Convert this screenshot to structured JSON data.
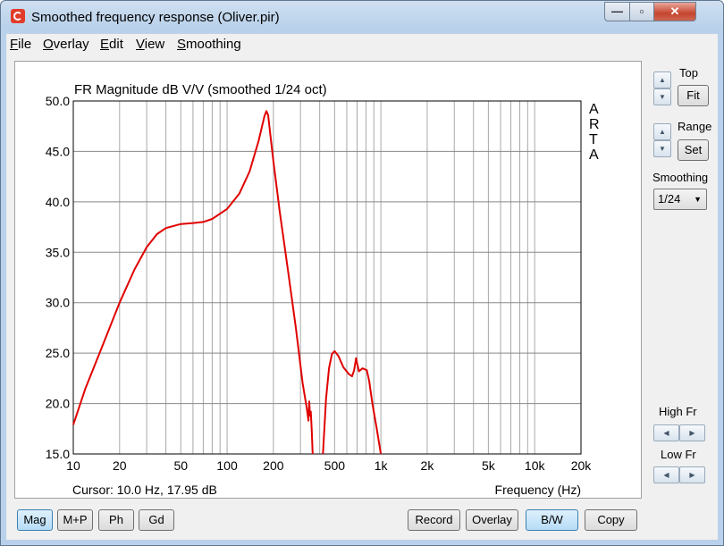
{
  "window": {
    "title": "Smoothed frequency response (Oliver.pir)",
    "min_glyph": "—",
    "max_glyph": "▫",
    "close_glyph": "✕"
  },
  "menu": [
    "File",
    "Overlay",
    "Edit",
    "View",
    "Smoothing"
  ],
  "chart_data": {
    "type": "line",
    "title": "FR Magnitude dB V/V (smoothed 1/24 oct)",
    "watermark": "ARTA",
    "xlabel": "Frequency (Hz)",
    "x_scale": "log",
    "xlim": [
      10,
      20000
    ],
    "ylim": [
      15,
      50
    ],
    "x_ticks": [
      10,
      20,
      50,
      100,
      200,
      500,
      1000,
      2000,
      5000,
      10000,
      20000
    ],
    "x_tick_labels": [
      "10",
      "20",
      "50",
      "100",
      "200",
      "500",
      "1k",
      "2k",
      "5k",
      "10k",
      "20k"
    ],
    "y_ticks": [
      15,
      20,
      25,
      30,
      35,
      40,
      45,
      50
    ],
    "y_tick_labels": [
      "15.0",
      "20.0",
      "25.0",
      "30.0",
      "35.0",
      "40.0",
      "45.0",
      "50.0"
    ],
    "grid": true,
    "series": [
      {
        "color": "#e00000",
        "segments": [
          [
            [
              10,
              17.9
            ],
            [
              12,
              21.5
            ],
            [
              15,
              25.2
            ],
            [
              20,
              30.0
            ],
            [
              25,
              33.3
            ],
            [
              30,
              35.5
            ],
            [
              35,
              36.8
            ],
            [
              40,
              37.4
            ],
            [
              50,
              37.8
            ],
            [
              60,
              37.9
            ],
            [
              70,
              38.0
            ],
            [
              80,
              38.3
            ],
            [
              100,
              39.3
            ],
            [
              120,
              40.8
            ],
            [
              140,
              43.0
            ],
            [
              160,
              46.0
            ],
            [
              175,
              48.5
            ],
            [
              180,
              49.0
            ],
            [
              185,
              48.6
            ],
            [
              190,
              47.0
            ],
            [
              200,
              44.0
            ],
            [
              220,
              39.0
            ],
            [
              250,
              33.0
            ],
            [
              280,
              27.5
            ],
            [
              310,
              22.0
            ],
            [
              330,
              19.5
            ],
            [
              338,
              18.3
            ],
            [
              342,
              20.2
            ],
            [
              346,
              18.8
            ],
            [
              350,
              19.2
            ],
            [
              355,
              17.5
            ],
            [
              360,
              15.0
            ]
          ],
          [
            [
              420,
              15.0
            ],
            [
              440,
              20.5
            ],
            [
              460,
              23.5
            ],
            [
              480,
              24.9
            ],
            [
              500,
              25.2
            ],
            [
              530,
              24.7
            ],
            [
              570,
              23.6
            ],
            [
              620,
              22.9
            ],
            [
              650,
              22.7
            ],
            [
              670,
              23.3
            ],
            [
              690,
              24.5
            ],
            [
              700,
              24.0
            ],
            [
              720,
              23.2
            ],
            [
              760,
              23.5
            ],
            [
              810,
              23.3
            ],
            [
              840,
              22.2
            ],
            [
              880,
              20.0
            ],
            [
              940,
              17.5
            ],
            [
              1000,
              15.0
            ]
          ]
        ]
      }
    ]
  },
  "readouts": {
    "cursor": "Cursor: 10.0 Hz, 17.95 dB",
    "axis_label": "Frequency (Hz)"
  },
  "side": {
    "top_label": "Top",
    "fit_label": "Fit",
    "range_label": "Range",
    "set_label": "Set",
    "smoothing_label": "Smoothing",
    "smoothing_value": "1/24",
    "high_fr_label": "High Fr",
    "low_fr_label": "Low Fr",
    "up_glyph": "▲",
    "down_glyph": "▼",
    "left_glyph": "◀",
    "right_glyph": "▶"
  },
  "bottom_left": [
    "Mag",
    "M+P",
    "Ph",
    "Gd"
  ],
  "bottom_right": [
    "Record",
    "Overlay",
    "B/W",
    "Copy"
  ],
  "colors": {
    "curve": "#e00000",
    "grid": "#a8a8a8",
    "active_button": "#b5dcf6"
  }
}
